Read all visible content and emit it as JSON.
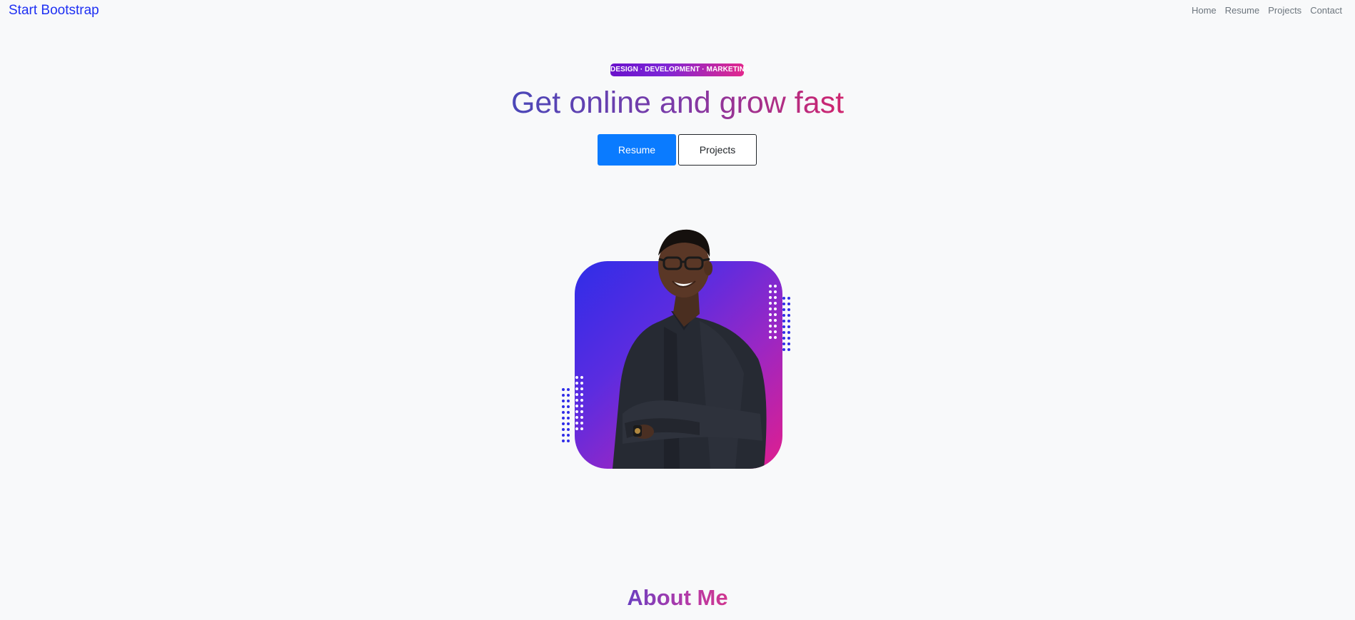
{
  "nav": {
    "brand": "Start Bootstrap",
    "links": [
      "Home",
      "Resume",
      "Projects",
      "Contact"
    ]
  },
  "hero": {
    "badge": "DESIGN · DEVELOPMENT · MARKETING",
    "title": "Get online and grow fast",
    "buttons": {
      "primary": "Resume",
      "secondary": "Projects"
    }
  },
  "about": {
    "title": "About Me"
  },
  "colors": {
    "brand": "#1e30f3",
    "primary_button": "#0a7bff",
    "gradient_start": "#2f2de8",
    "gradient_end": "#e01e8e"
  }
}
